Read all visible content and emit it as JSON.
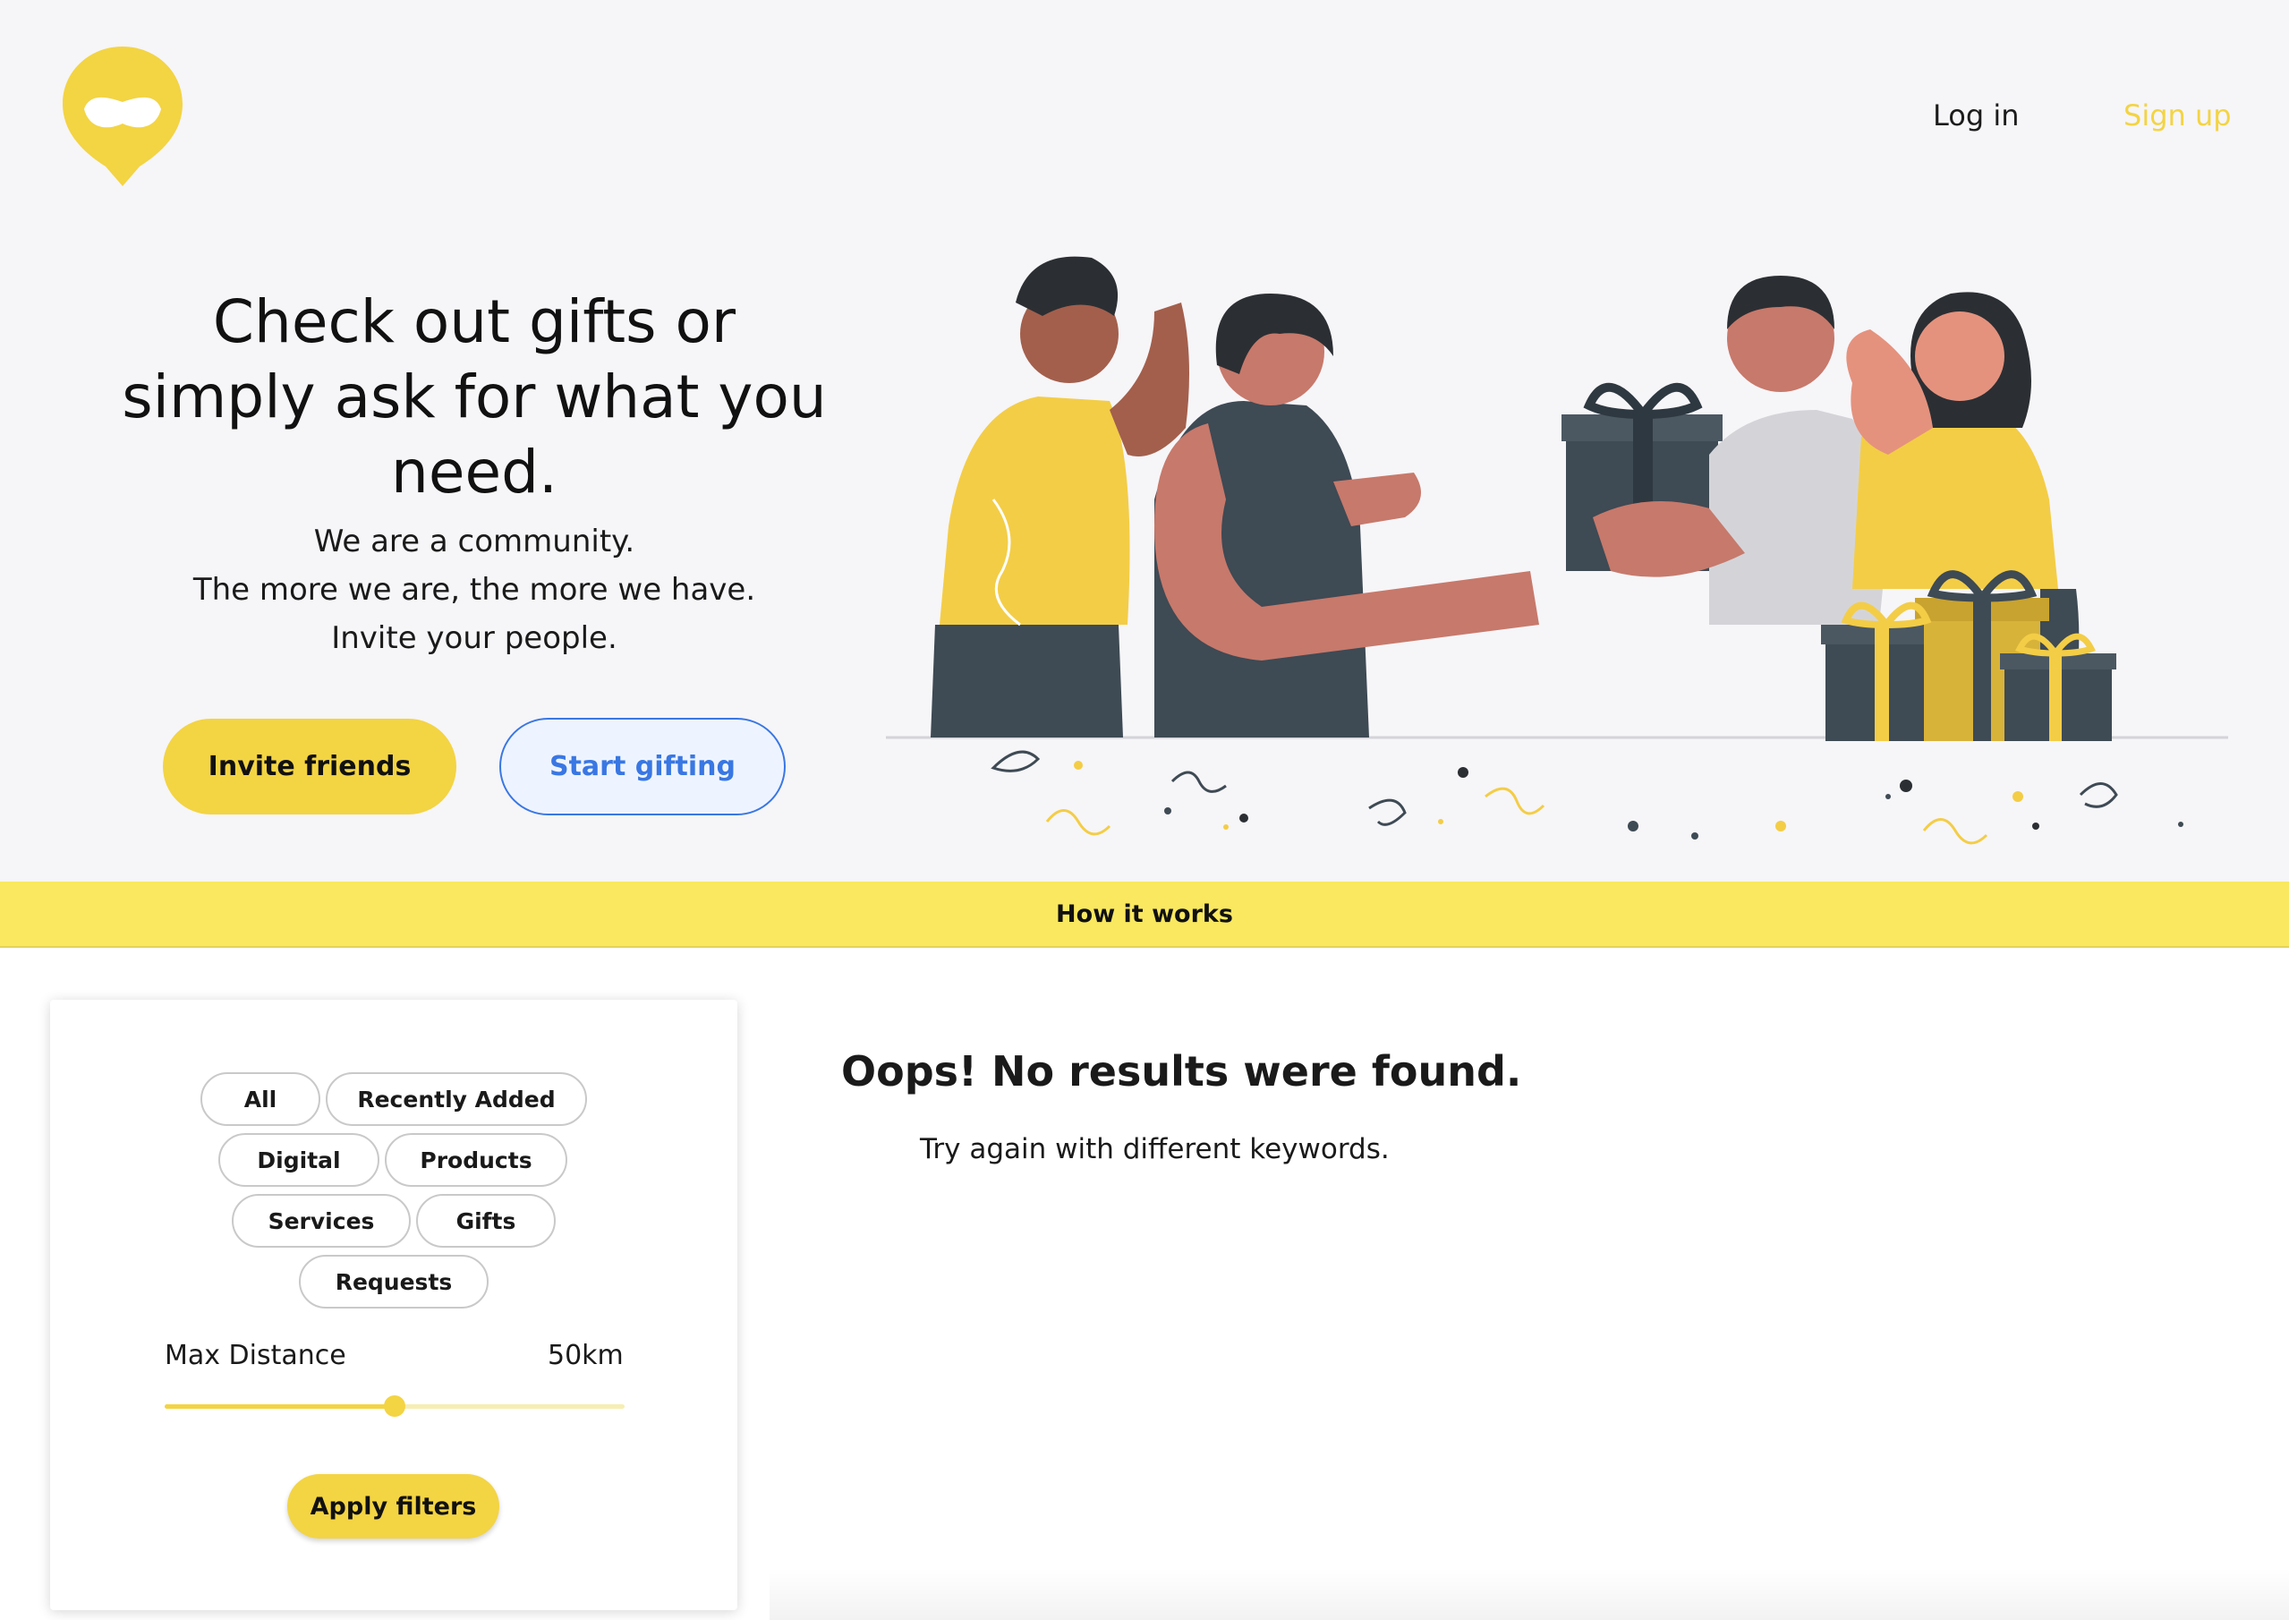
{
  "nav": {
    "login": "Log in",
    "signup": "Sign up"
  },
  "hero": {
    "headline": [
      "Check out gifts or",
      "simply ask for what you need."
    ],
    "tagline": [
      "We are a community.",
      "The more we are, the more we have.",
      "Invite your people."
    ],
    "invite_button": "Invite friends",
    "start_button": "Start gifting"
  },
  "how_it_works": "How it works",
  "filters": {
    "categories": [
      {
        "label": "All",
        "selected": false
      },
      {
        "label": "Recently Added",
        "selected": false
      },
      {
        "label": "Digital",
        "selected": false
      },
      {
        "label": "Products",
        "selected": false
      },
      {
        "label": "Services",
        "selected": false
      },
      {
        "label": "Gifts",
        "selected": false
      },
      {
        "label": "Requests",
        "selected": false
      }
    ],
    "distance_label": "Max Distance",
    "distance_value": "50km",
    "distance_fraction": 0.5,
    "apply_button": "Apply filters"
  },
  "results": {
    "title": "Oops! No results were found.",
    "subtitle": "Try again with different keywords."
  },
  "colors": {
    "brand_yellow": "#f3d443",
    "accent_blue": "#3977e3",
    "bar_yellow": "#f9e860",
    "ink": "#3e4a54"
  },
  "icons": {
    "logo": "speech-bubble-smile-icon"
  }
}
